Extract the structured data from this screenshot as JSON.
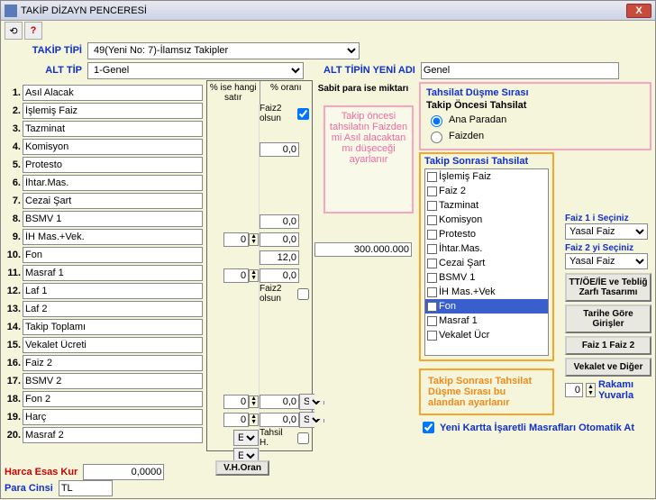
{
  "window": {
    "title": "TAKİP DİZAYN PENCERESİ"
  },
  "header": {
    "takip_tipi_label": "TAKİP TİPİ",
    "takip_tipi_value": "49(Yeni No: 7)-İlamsız Takipler",
    "alt_tip_label": "ALT TİP",
    "alt_tip_value": "1-Genel",
    "alt_tip_yeni_adi_label": "ALT TİPİN YENİ ADI",
    "alt_tip_yeni_adi_value": "Genel"
  },
  "rows": [
    {
      "n": "1.",
      "v": "Asıl Alacak"
    },
    {
      "n": "2.",
      "v": "İşlemiş Faiz"
    },
    {
      "n": "3.",
      "v": "Tazminat"
    },
    {
      "n": "4.",
      "v": "Komisyon"
    },
    {
      "n": "5.",
      "v": "Protesto"
    },
    {
      "n": "6.",
      "v": "İhtar.Mas."
    },
    {
      "n": "7.",
      "v": "Cezai Şart"
    },
    {
      "n": "8.",
      "v": "BSMV 1"
    },
    {
      "n": "9.",
      "v": "İH Mas.+Vek."
    },
    {
      "n": "10.",
      "v": "Fon"
    },
    {
      "n": "11.",
      "v": "Masraf 1"
    },
    {
      "n": "12.",
      "v": "Laf 1"
    },
    {
      "n": "13.",
      "v": "Laf 2"
    },
    {
      "n": "14.",
      "v": "Takip Toplamı"
    },
    {
      "n": "15.",
      "v": "Vekalet Ücreti"
    },
    {
      "n": "16.",
      "v": "Faiz 2"
    },
    {
      "n": "17.",
      "v": "BSMV 2"
    },
    {
      "n": "18.",
      "v": "Fon 2"
    },
    {
      "n": "19.",
      "v": "Harç"
    },
    {
      "n": "20.",
      "v": "Masraf 2"
    }
  ],
  "mid": {
    "hd1": "% ise hangi satır",
    "hd2": "% oranı",
    "faiz2_label": "Faiz2 olsun",
    "tahsil_label": "Tahsil H.",
    "spins": [
      "",
      "",
      "",
      "",
      "",
      "",
      "",
      "0",
      "",
      "0",
      "",
      "",
      "",
      "",
      "",
      "",
      "0",
      "0",
      "",
      ""
    ],
    "decs": [
      "",
      "",
      "0,0",
      "",
      "",
      "",
      "0,0",
      "0,0",
      "12,0",
      "0,0",
      "",
      "",
      "",
      "",
      "",
      "",
      "0,0",
      "0,0",
      "",
      ""
    ],
    "sel19": "E",
    "sel20": "E",
    "sel17": "S",
    "sel18": "S"
  },
  "sabit": {
    "hd": "Sabit para ise miktarı",
    "vals": [
      "",
      "",
      "",
      "",
      "",
      "",
      "",
      "",
      "300.000.000",
      "",
      "",
      "",
      "",
      "",
      "",
      "",
      "",
      "",
      "",
      ""
    ]
  },
  "pink_note": "Takip öncesi tahsilatın Faizden mi Asıl alacaktan mı düşeceği ayarlanır",
  "grp1": {
    "title1": "Tahsilat Düşme Sırası",
    "title2": "Takip Öncesi Tahsilat",
    "opt1": "Ana Paradan",
    "opt2": "Faizden"
  },
  "grp2": {
    "title": "Takip Sonrasi Tahsilat",
    "items": [
      "İşlemiş Faiz",
      "Faiz 2",
      "Tazminat",
      "Komisyon",
      "Protesto",
      "İhtar.Mas.",
      "Cezai Şart",
      "BSMV 1",
      "İH Mas.+Vek",
      "Fon",
      "Masraf 1",
      "Vekalet Ücr"
    ],
    "selected_index": 9
  },
  "orange_note": "Takip Sonrası Tahsilat Düşme Sırası bu alandan ayarlanır",
  "far_right": {
    "faiz1_label": "Faiz 1 i Seçiniz",
    "faiz1_value": "Yasal Faiz",
    "faiz2_label": "Faiz 2 yi Seçiniz",
    "faiz2_value": "Yasal Faiz",
    "btn1": "TT/ÖE/İE ve Tebliğ Zarfı Tasarımı",
    "btn2": "Tarihe Göre Girişler",
    "btn3": "Faiz 1  Faiz 2",
    "btn4": "Vekalet ve Diğer",
    "rakam_label": "Rakamı Yuvarla",
    "rakam_val": "0",
    "chk1": "Yeni Kartta İşaretli Masrafları Otomatik At"
  },
  "bottom": {
    "para_label": "Para Cinsi",
    "para_value": "TL",
    "harca_label": "Harca Esas Kur",
    "harca_value": "0,0000",
    "vho": "V.H.Oran"
  }
}
